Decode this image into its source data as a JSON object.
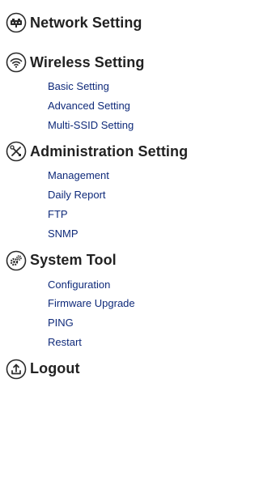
{
  "menu": {
    "network": {
      "title": "Network Setting",
      "icon": "network-icon"
    },
    "wireless": {
      "title": "Wireless Setting",
      "icon": "wifi-icon",
      "items": [
        "Basic Setting",
        "Advanced Setting",
        "Multi-SSID Setting"
      ]
    },
    "administration": {
      "title": "Administration Setting",
      "icon": "tools-icon",
      "items": [
        "Management",
        "Daily Report",
        "FTP",
        "SNMP"
      ]
    },
    "system_tool": {
      "title": "System Tool",
      "icon": "gears-icon",
      "items": [
        "Configuration",
        "Firmware Upgrade",
        "PING",
        "Restart"
      ]
    },
    "logout": {
      "title": "Logout",
      "icon": "logout-icon"
    }
  },
  "colors": {
    "title": "#222222",
    "link": "#0f2a7a",
    "icon_stroke": "#2a2a2a"
  }
}
